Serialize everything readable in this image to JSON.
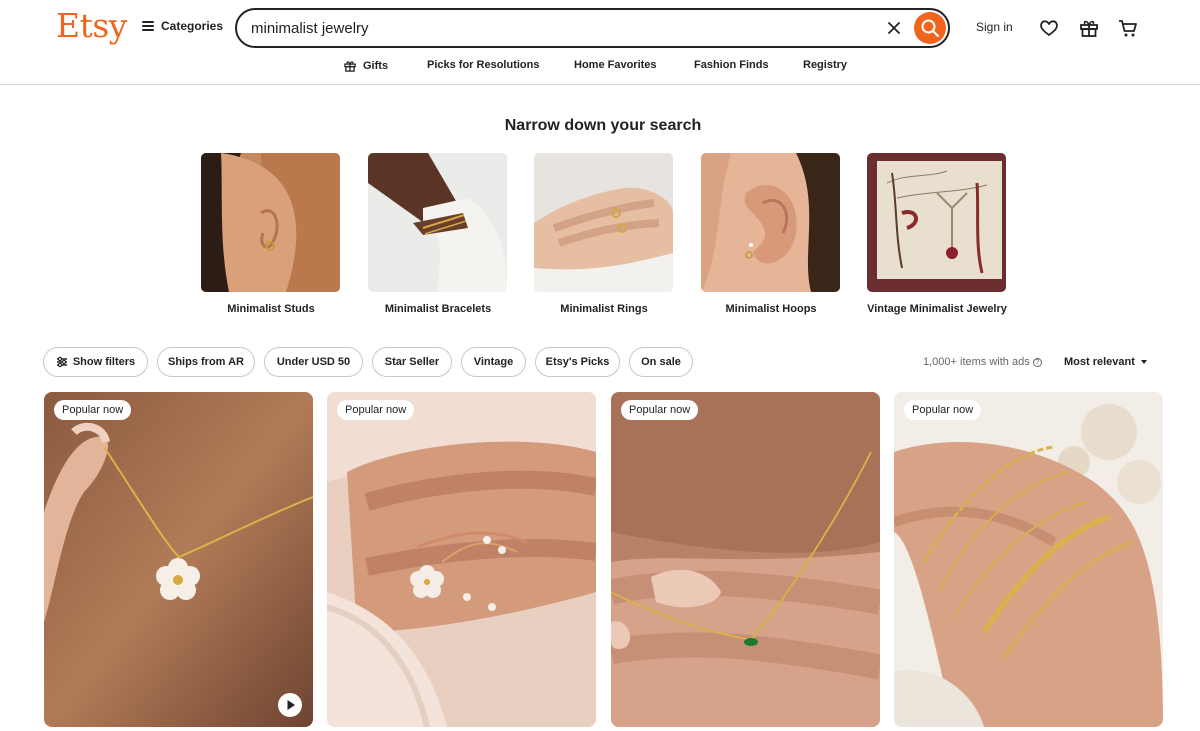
{
  "header": {
    "logo": "Etsy",
    "categories_label": "Categories",
    "search": {
      "value": "minimalist jewelry",
      "placeholder": "Search for anything"
    },
    "sign_in_label": "Sign in",
    "icons": [
      "menu-icon",
      "close-icon",
      "search-icon",
      "heart-icon",
      "gift-icon",
      "cart-icon"
    ]
  },
  "nav": {
    "items": [
      {
        "label": "Gifts",
        "icon": "gift-icon"
      },
      {
        "label": "Picks for Resolutions"
      },
      {
        "label": "Home Favorites"
      },
      {
        "label": "Fashion Finds"
      },
      {
        "label": "Registry"
      }
    ]
  },
  "narrow": {
    "title": "Narrow down your search",
    "categories": [
      {
        "label": "Minimalist Studs"
      },
      {
        "label": "Minimalist Bracelets"
      },
      {
        "label": "Minimalist Rings"
      },
      {
        "label": "Minimalist Hoops"
      },
      {
        "label": "Vintage Minimalist Jewelry"
      }
    ]
  },
  "filters": {
    "show_filters_label": "Show filters",
    "chips": [
      "Ships from AR",
      "Under USD 50",
      "Star Seller",
      "Vintage",
      "Etsy's Picks",
      "On sale"
    ],
    "results_count": "1,000+ items with ads",
    "sort_label": "Most relevant"
  },
  "listings": [
    {
      "badge": "Popular now",
      "has_video": true
    },
    {
      "badge": "Popular now"
    },
    {
      "badge": "Popular now"
    },
    {
      "badge": "Popular now"
    }
  ],
  "colors": {
    "brand": "#f1641e",
    "text": "#222222",
    "border": "#c8c8c8"
  }
}
